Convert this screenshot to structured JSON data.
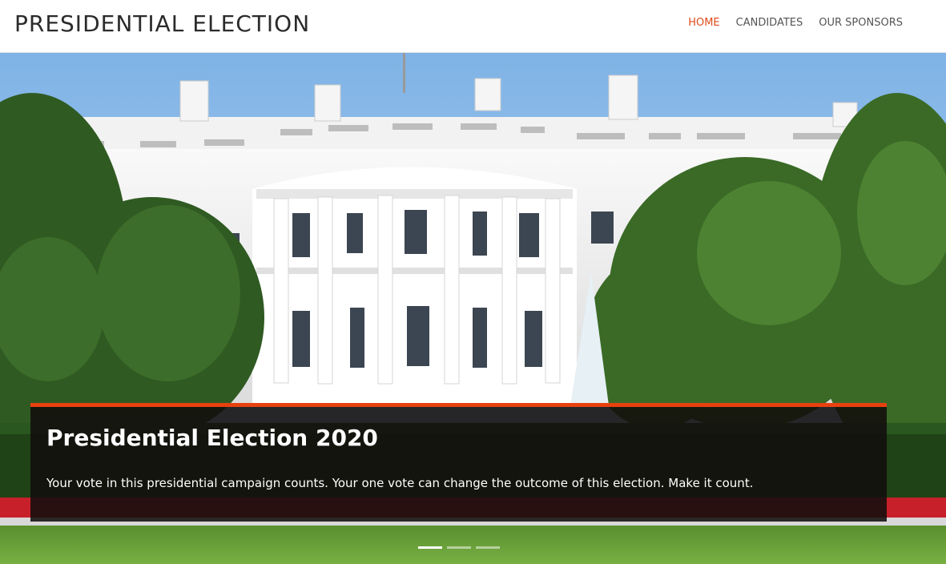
{
  "header": {
    "brand": "PRESIDENTIAL ELECTION",
    "nav": [
      {
        "label": "HOME",
        "active": true
      },
      {
        "label": "CANDIDATES",
        "active": false
      },
      {
        "label": "OUR SPONSORS",
        "active": false
      }
    ]
  },
  "hero": {
    "image": "white-house-photo",
    "caption_title": "Presidential Election 2020",
    "caption_text": "Your vote in this presidential campaign counts. Your one vote can change the outcome of this election. Make it count.",
    "slide_count": 3,
    "active_slide": 1
  },
  "colors": {
    "accent": "#e8410f",
    "nav_active": "#e04a1b",
    "caption_bg": "#120e0c"
  }
}
